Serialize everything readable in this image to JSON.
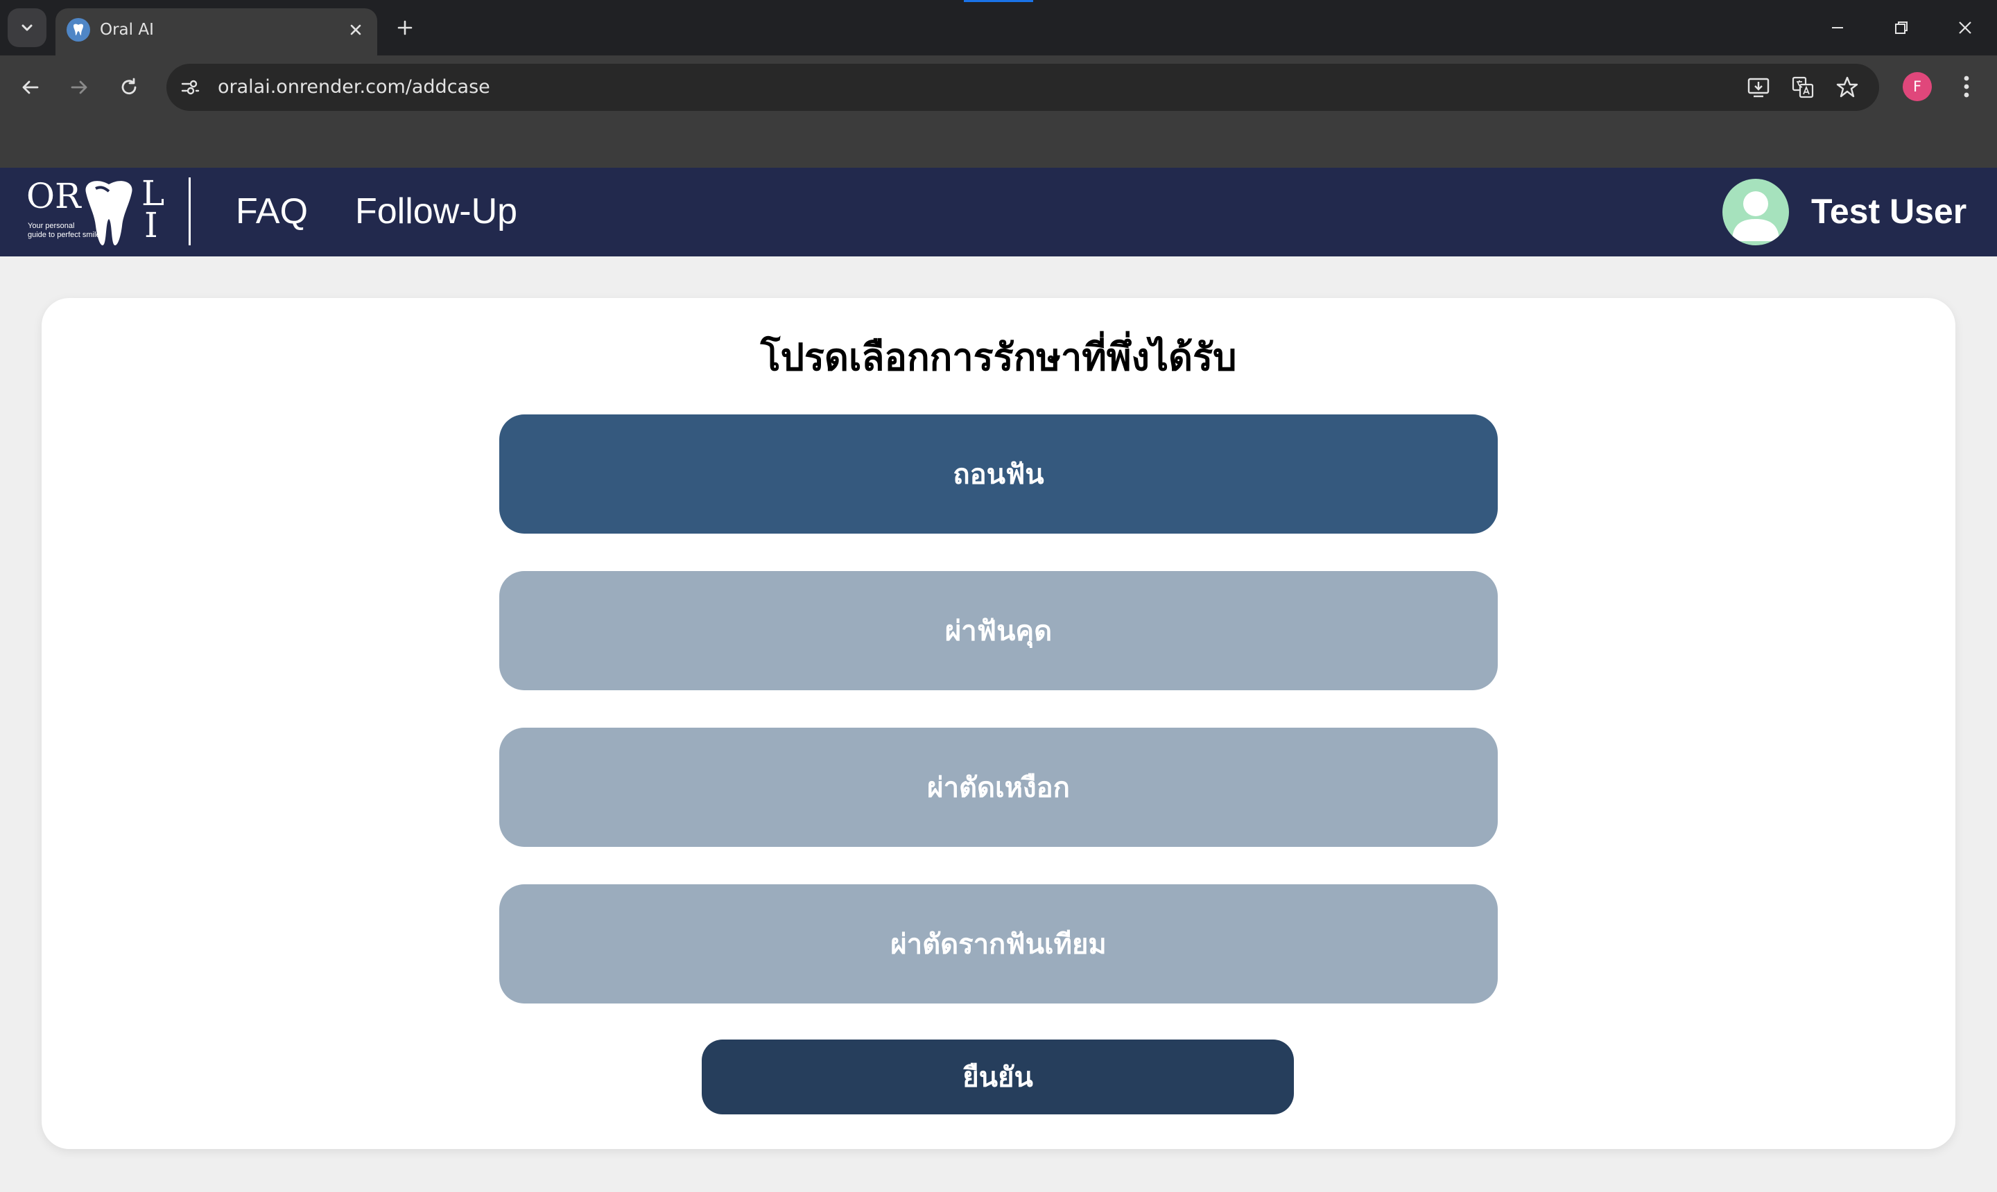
{
  "browser": {
    "tab_title": "Oral AI",
    "url": "oralai.onrender.com/addcase",
    "profile_initial": "F"
  },
  "header": {
    "logo": {
      "left_letters": "OR",
      "right_letter_top": "L",
      "right_letter_bottom": "I",
      "tagline_line1": "Your personal",
      "tagline_line2": "guide to perfect smile"
    },
    "nav": [
      {
        "label": "FAQ"
      },
      {
        "label": "Follow-Up"
      }
    ],
    "user_name": "Test User"
  },
  "main": {
    "title": "โปรดเลือกการรักษาที่พึ่งได้รับ",
    "options": [
      {
        "label": "ถอนฟัน",
        "selected": true
      },
      {
        "label": "ผ่าฟันคุด",
        "selected": false
      },
      {
        "label": "ผ่าตัดเหงือก",
        "selected": false
      },
      {
        "label": "ผ่าตัดรากฟันเทียม",
        "selected": false
      }
    ],
    "confirm_label": "ยืนยัน"
  },
  "colors": {
    "header_bg": "#22294d",
    "selected_option": "#35597e",
    "unselected_option": "#9bacbd",
    "confirm_button": "#263e5c",
    "page_bg": "#efefef"
  }
}
